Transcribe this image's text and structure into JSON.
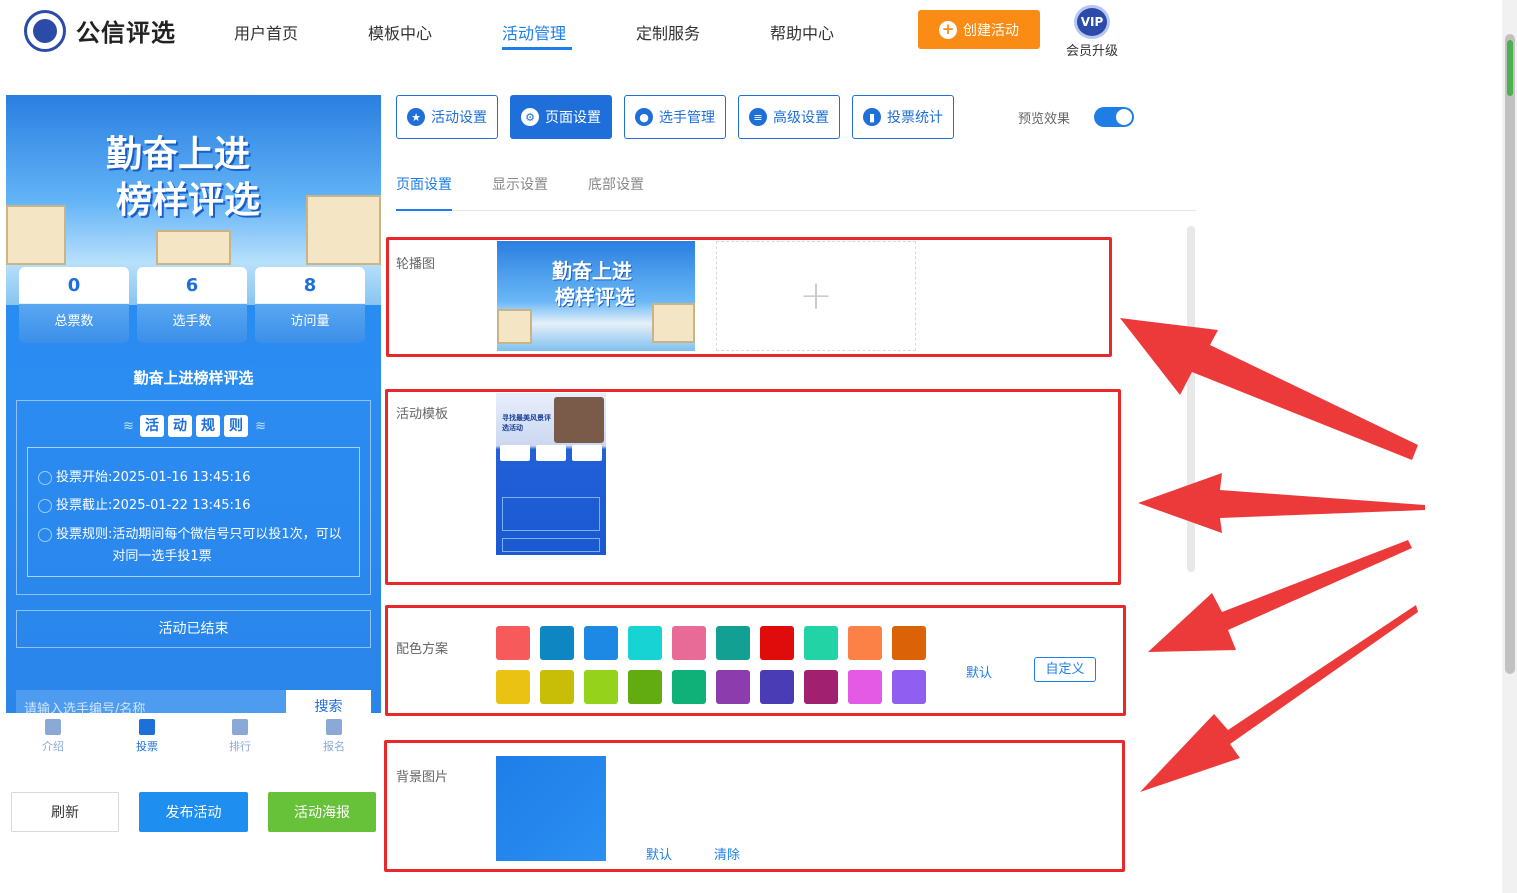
{
  "header": {
    "brand": "公信评选",
    "nav": [
      "用户首页",
      "模板中心",
      "活动管理",
      "定制服务",
      "帮助中心"
    ],
    "active_nav": "活动管理",
    "create_button": "创建活动",
    "vip_badge": "VIP",
    "vip_label": "会员升级"
  },
  "preview": {
    "banner_line1": "勤奋上进",
    "banner_line2": "榜样评选",
    "stats": [
      {
        "value": "0",
        "label": "总票数"
      },
      {
        "value": "6",
        "label": "选手数"
      },
      {
        "value": "8",
        "label": "访问量"
      }
    ],
    "title": "勤奋上进榜样评选",
    "rules_title": [
      "活",
      "动",
      "规",
      "则"
    ],
    "rules": [
      {
        "label": "投票开始:",
        "value": "2025-01-16 13:45:16"
      },
      {
        "label": "投票截止:",
        "value": "2025-01-22 13:45:16"
      },
      {
        "label": "投票规则:",
        "value": "活动期间每个微信号只可以投1次，可以对同一选手投1票"
      }
    ],
    "ended": "活动已结束",
    "search_placeholder": "请输入选手编号/名称",
    "search_button": "搜索",
    "tabs": [
      "介绍",
      "投票",
      "排行",
      "报名"
    ],
    "active_tab": "投票"
  },
  "actions": {
    "refresh": "刷新",
    "publish": "发布活动",
    "poster": "活动海报"
  },
  "toolbar": {
    "buttons": [
      "活动设置",
      "页面设置",
      "选手管理",
      "高级设置",
      "投票统计"
    ],
    "active": "页面设置",
    "preview_label": "预览效果",
    "preview_on": true
  },
  "subtabs": [
    "页面设置",
    "显示设置",
    "底部设置"
  ],
  "sections": {
    "carousel_label": "轮播图",
    "carousel_banner_line1": "勤奋上进",
    "carousel_banner_line2": "榜样评选",
    "upload_plus": "+",
    "template_label": "活动模板",
    "template_title": "寻找最美风景评选活动",
    "color_label": "配色方案",
    "color_default": "默认",
    "color_custom": "自定义",
    "bg_label": "背景图片",
    "bg_default": "默认",
    "bg_clear": "清除"
  },
  "colors": {
    "row1": [
      "#f65a5b",
      "#0e86c1",
      "#1e88e5",
      "#17d3d3",
      "#e76a97",
      "#12a093",
      "#e00c0c",
      "#22d3a6",
      "#fb8147",
      "#dc6208"
    ],
    "row2": [
      "#e9c214",
      "#c8be08",
      "#94d21c",
      "#62ab10",
      "#0fb179",
      "#8c3cac",
      "#4a3cb4",
      "#a12170",
      "#e45ae4",
      "#915ef2"
    ],
    "accent": "#1e7ee8",
    "annotation": "#e8282b"
  }
}
